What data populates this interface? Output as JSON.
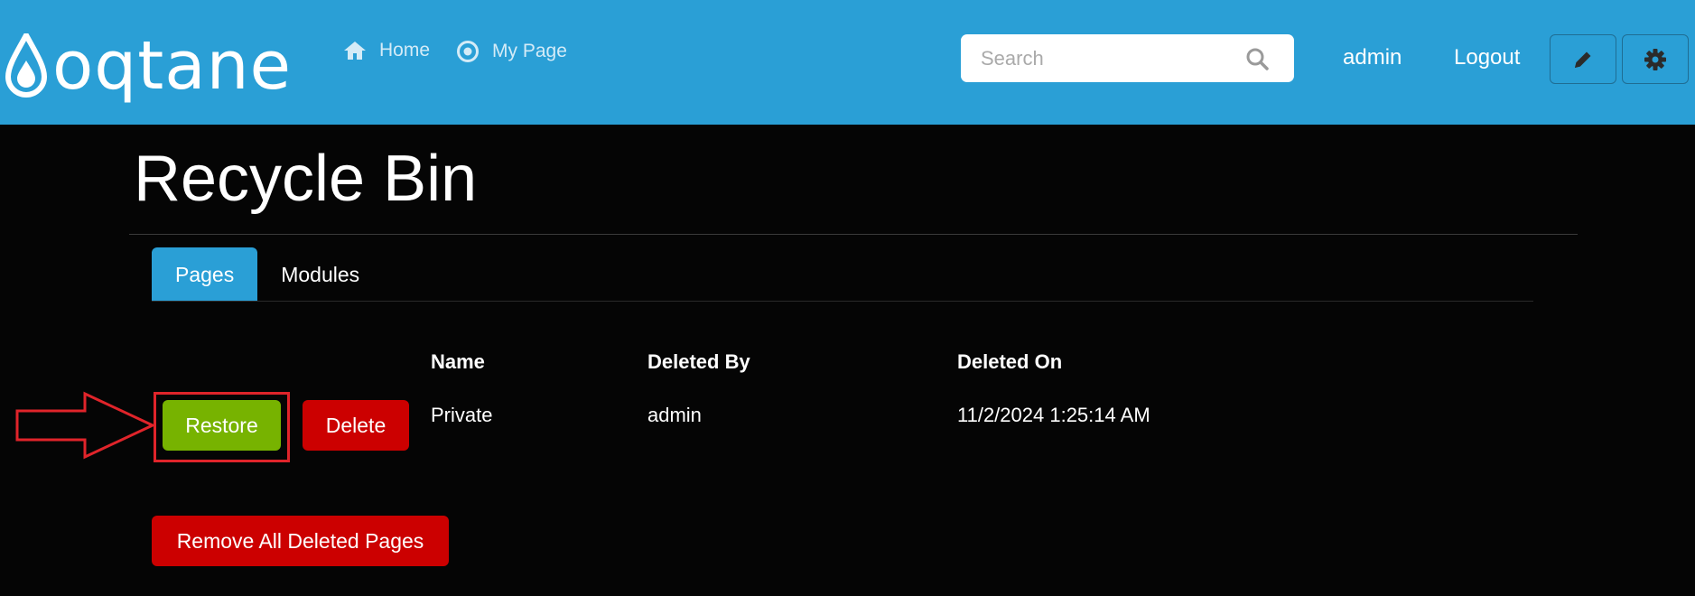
{
  "header": {
    "logo_text": "oqtane",
    "nav": [
      {
        "label": "Home",
        "icon": "home-icon"
      },
      {
        "label": "My Page",
        "icon": "target-icon"
      }
    ],
    "search": {
      "placeholder": "Search",
      "value": "",
      "icon": "search-icon"
    },
    "user_label": "admin",
    "logout_label": "Logout",
    "action_buttons": [
      {
        "icon": "pencil-icon"
      },
      {
        "icon": "gear-icon"
      }
    ],
    "bar_color": "#2a9fd6"
  },
  "page": {
    "title": "Recycle Bin",
    "tabs": [
      {
        "label": "Pages",
        "active": true
      },
      {
        "label": "Modules",
        "active": false
      }
    ],
    "table": {
      "columns": [
        "Name",
        "Deleted By",
        "Deleted On"
      ],
      "rows": [
        {
          "restore_label": "Restore",
          "delete_label": "Delete",
          "name": "Private",
          "deleted_by": "admin",
          "deleted_on": "11/2/2024 1:25:14 AM"
        }
      ]
    },
    "remove_all_label": "Remove All Deleted Pages"
  },
  "annotation": {
    "highlight_color": "#e0242a",
    "target": "Restore"
  },
  "colors": {
    "accent": "#2a9fd6",
    "success": "#77b300",
    "danger": "#cc0000",
    "background": "#050505"
  }
}
